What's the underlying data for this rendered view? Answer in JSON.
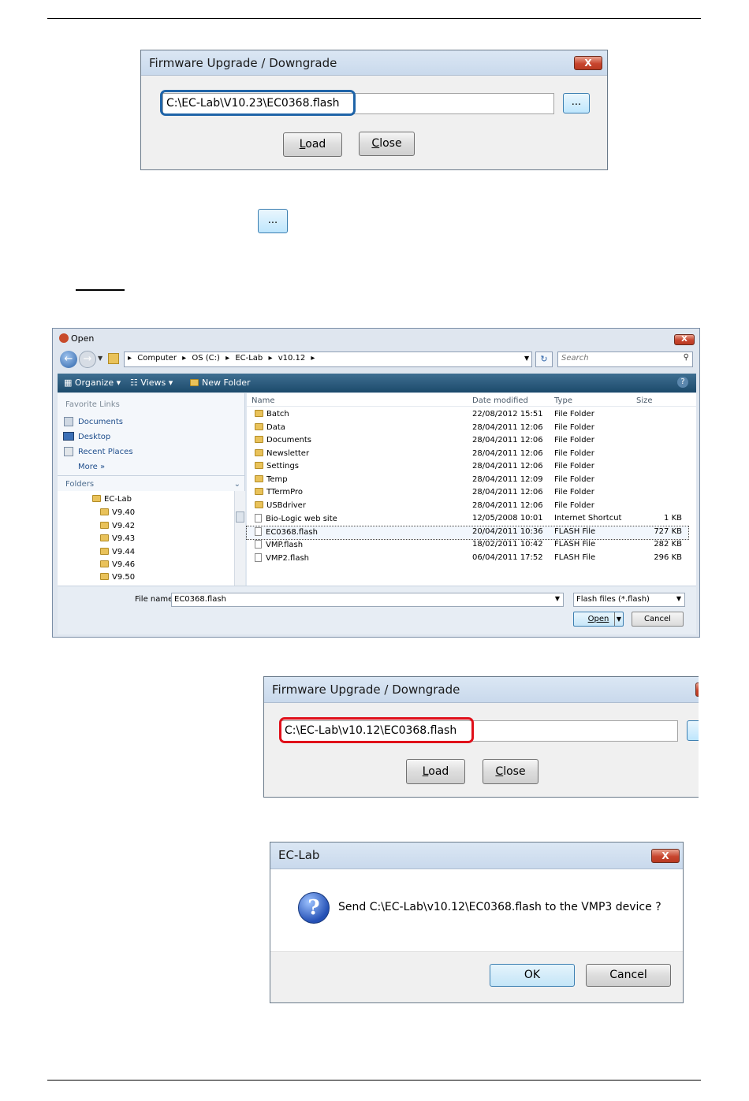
{
  "fw_dialog_1": {
    "title": "Firmware Upgrade / Downgrade",
    "close_label": "X",
    "path_value": "C:\\EC-Lab\\V10.23\\EC0368.flash",
    "browse_label": "...",
    "load_pre": "",
    "load_u": "L",
    "load_post": "oad",
    "close_btn_pre": "",
    "close_btn_u": "C",
    "close_btn_post": "lose"
  },
  "browse_button_standalone": {
    "label": "..."
  },
  "open_dialog": {
    "title": "Open",
    "breadcrumb": [
      "Computer",
      "OS (C:)",
      "EC-Lab",
      "v10.12"
    ],
    "search_placeholder": "Search",
    "toolbar": {
      "organize": "Organize",
      "views": "Views",
      "new_folder": "New Folder",
      "help": "?"
    },
    "favorite_links_header": "Favorite Links",
    "favorite_links": [
      "Documents",
      "Desktop",
      "Recent Places"
    ],
    "more_label": "More",
    "folders_header": "Folders",
    "tree": [
      "EC-Lab",
      "V9.40",
      "V9.42",
      "V9.43",
      "V9.44",
      "V9.46",
      "V9.50"
    ],
    "columns": {
      "name": "Name",
      "date": "Date modified",
      "type": "Type",
      "size": "Size"
    },
    "rows": [
      {
        "name": "Batch",
        "date": "22/08/2012 15:51",
        "type": "File Folder",
        "size": ""
      },
      {
        "name": "Data",
        "date": "28/04/2011 12:06",
        "type": "File Folder",
        "size": ""
      },
      {
        "name": "Documents",
        "date": "28/04/2011 12:06",
        "type": "File Folder",
        "size": ""
      },
      {
        "name": "Newsletter",
        "date": "28/04/2011 12:06",
        "type": "File Folder",
        "size": ""
      },
      {
        "name": "Settings",
        "date": "28/04/2011 12:06",
        "type": "File Folder",
        "size": ""
      },
      {
        "name": "Temp",
        "date": "28/04/2011 12:09",
        "type": "File Folder",
        "size": ""
      },
      {
        "name": "TTermPro",
        "date": "28/04/2011 12:06",
        "type": "File Folder",
        "size": ""
      },
      {
        "name": "USBdriver",
        "date": "28/04/2011 12:06",
        "type": "File Folder",
        "size": ""
      },
      {
        "name": "Bio-Logic web site",
        "date": "12/05/2008 10:01",
        "type": "Internet Shortcut",
        "size": "1 KB"
      },
      {
        "name": "EC0368.flash",
        "date": "20/04/2011 10:36",
        "type": "FLASH File",
        "size": "727 KB"
      },
      {
        "name": "VMP.flash",
        "date": "18/02/2011 10:42",
        "type": "FLASH File",
        "size": "282 KB"
      },
      {
        "name": "VMP2.flash",
        "date": "06/04/2011 17:52",
        "type": "FLASH File",
        "size": "296 KB"
      }
    ],
    "filename_label": "File name:",
    "filename_value": "EC0368.flash",
    "filter_value": "Flash files (*.flash)",
    "open_label": "Open",
    "cancel_label": "Cancel"
  },
  "fw_dialog_2": {
    "title": "Firmware Upgrade / Downgrade",
    "path_value": "C:\\EC-Lab\\v10.12\\EC0368.flash",
    "load_u": "L",
    "load_post": "oad",
    "close_btn_u": "C",
    "close_btn_post": "lose"
  },
  "confirm_dialog": {
    "title": "EC-Lab",
    "close_label": "X",
    "icon_glyph": "?",
    "message": "Send C:\\EC-Lab\\v10.12\\EC0368.flash to the VMP3 device ?",
    "ok_label": "OK",
    "cancel_label": "Cancel"
  }
}
